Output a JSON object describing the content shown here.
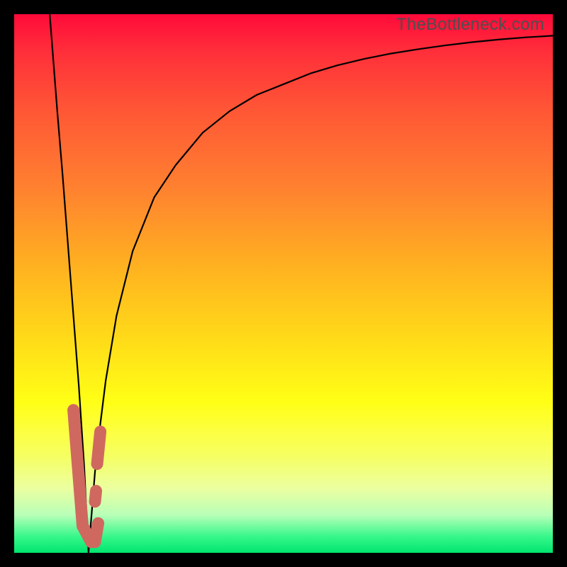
{
  "watermark": "TheBottleneck.com",
  "chart_data": {
    "type": "line",
    "title": "",
    "xlabel": "",
    "ylabel": "",
    "xlim": [
      0,
      100
    ],
    "ylim": [
      0,
      100
    ],
    "grid": false,
    "note": "Axis values are estimated from pixel positions; the chart has no visible numeric ticks. x≈13.8 is the zero-bottleneck point where the curve touches y=0.",
    "series": [
      {
        "name": "bottleneck-curve",
        "x": [
          6.6,
          8,
          9,
          10,
          11,
          12,
          13,
          13.8,
          15,
          16,
          17,
          19,
          22,
          26,
          30,
          35,
          40,
          45,
          50,
          55,
          60,
          65,
          70,
          75,
          80,
          85,
          90,
          95,
          100
        ],
        "y": [
          100,
          82,
          70,
          57,
          44,
          31,
          16,
          0,
          15,
          24,
          32,
          44,
          56,
          66,
          72,
          78,
          82,
          85,
          87,
          89,
          90.5,
          91.7,
          92.7,
          93.5,
          94.2,
          94.8,
          95.3,
          95.7,
          96
        ]
      }
    ],
    "markers": {
      "note": "Salmon-colored capsule markers near the vertex of the curve",
      "points": [
        {
          "x1": 11.0,
          "y1": 26.5,
          "x2": 12.7,
          "y2": 5.0
        },
        {
          "x1": 12.7,
          "y1": 5.0,
          "x2": 14.3,
          "y2": 2.0
        },
        {
          "x1": 15.4,
          "y1": 16.5,
          "x2": 16.0,
          "y2": 22.5
        },
        {
          "x1": 15.0,
          "y1": 9.5,
          "x2": 15.2,
          "y2": 11.5
        },
        {
          "x1": 15.0,
          "y1": 2.0,
          "x2": 15.6,
          "y2": 5.5
        }
      ]
    }
  }
}
